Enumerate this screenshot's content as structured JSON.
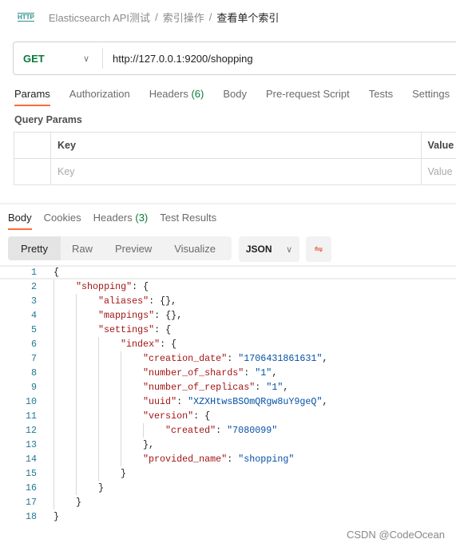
{
  "breadcrumb": {
    "icon": "http-icon",
    "icon_text": "HTTP",
    "items": [
      "Elasticsearch API测试",
      "索引操作"
    ],
    "current": "查看单个索引",
    "separator": "/"
  },
  "request": {
    "method": "GET",
    "url": "http://127.0.0.1:9200/shopping"
  },
  "request_tabs": [
    {
      "label": "Params",
      "active": true
    },
    {
      "label": "Authorization"
    },
    {
      "label": "Headers",
      "count": "(6)"
    },
    {
      "label": "Body"
    },
    {
      "label": "Pre-request Script"
    },
    {
      "label": "Tests"
    },
    {
      "label": "Settings"
    }
  ],
  "query_params": {
    "title": "Query Params",
    "headers": [
      "Key",
      "Value"
    ],
    "placeholders": [
      "Key",
      "Value"
    ]
  },
  "response_tabs": [
    {
      "label": "Body",
      "active": true
    },
    {
      "label": "Cookies"
    },
    {
      "label": "Headers",
      "count": "(3)"
    },
    {
      "label": "Test Results"
    }
  ],
  "format_tabs": [
    "Pretty",
    "Raw",
    "Preview",
    "Visualize"
  ],
  "language": "JSON",
  "colors": {
    "accent": "#ff6c37",
    "key": "#a31515",
    "value": "#0451a5",
    "method": "#0b7a3b"
  },
  "code": [
    {
      "n": "1",
      "i": 0,
      "parts": [
        [
          "p",
          "{"
        ]
      ]
    },
    {
      "n": "2",
      "i": 1,
      "parts": [
        [
          "k",
          "\"shopping\""
        ],
        [
          "p",
          ": {"
        ]
      ]
    },
    {
      "n": "3",
      "i": 2,
      "parts": [
        [
          "k",
          "\"aliases\""
        ],
        [
          "p",
          ": {},"
        ]
      ]
    },
    {
      "n": "4",
      "i": 2,
      "parts": [
        [
          "k",
          "\"mappings\""
        ],
        [
          "p",
          ": {},"
        ]
      ]
    },
    {
      "n": "5",
      "i": 2,
      "parts": [
        [
          "k",
          "\"settings\""
        ],
        [
          "p",
          ": {"
        ]
      ]
    },
    {
      "n": "6",
      "i": 3,
      "parts": [
        [
          "k",
          "\"index\""
        ],
        [
          "p",
          ": {"
        ]
      ]
    },
    {
      "n": "7",
      "i": 4,
      "parts": [
        [
          "k",
          "\"creation_date\""
        ],
        [
          "p",
          ": "
        ],
        [
          "v",
          "\"1706431861631\""
        ],
        [
          "p",
          ","
        ]
      ]
    },
    {
      "n": "8",
      "i": 4,
      "parts": [
        [
          "k",
          "\"number_of_shards\""
        ],
        [
          "p",
          ": "
        ],
        [
          "v",
          "\"1\""
        ],
        [
          "p",
          ","
        ]
      ]
    },
    {
      "n": "9",
      "i": 4,
      "parts": [
        [
          "k",
          "\"number_of_replicas\""
        ],
        [
          "p",
          ": "
        ],
        [
          "v",
          "\"1\""
        ],
        [
          "p",
          ","
        ]
      ]
    },
    {
      "n": "10",
      "i": 4,
      "parts": [
        [
          "k",
          "\"uuid\""
        ],
        [
          "p",
          ": "
        ],
        [
          "v",
          "\"XZXHtwsBSOmQRgw8uY9geQ\""
        ],
        [
          "p",
          ","
        ]
      ]
    },
    {
      "n": "11",
      "i": 4,
      "parts": [
        [
          "k",
          "\"version\""
        ],
        [
          "p",
          ": {"
        ]
      ]
    },
    {
      "n": "12",
      "i": 5,
      "parts": [
        [
          "k",
          "\"created\""
        ],
        [
          "p",
          ": "
        ],
        [
          "v",
          "\"7080099\""
        ]
      ]
    },
    {
      "n": "13",
      "i": 4,
      "parts": [
        [
          "p",
          "},"
        ]
      ]
    },
    {
      "n": "14",
      "i": 4,
      "parts": [
        [
          "k",
          "\"provided_name\""
        ],
        [
          "p",
          ": "
        ],
        [
          "v",
          "\"shopping\""
        ]
      ]
    },
    {
      "n": "15",
      "i": 3,
      "parts": [
        [
          "p",
          "}"
        ]
      ]
    },
    {
      "n": "16",
      "i": 2,
      "parts": [
        [
          "p",
          "}"
        ]
      ]
    },
    {
      "n": "17",
      "i": 1,
      "parts": [
        [
          "p",
          "}"
        ]
      ]
    },
    {
      "n": "18",
      "i": 0,
      "parts": [
        [
          "p",
          "}"
        ]
      ]
    }
  ],
  "watermark": "CSDN @CodeOcean"
}
